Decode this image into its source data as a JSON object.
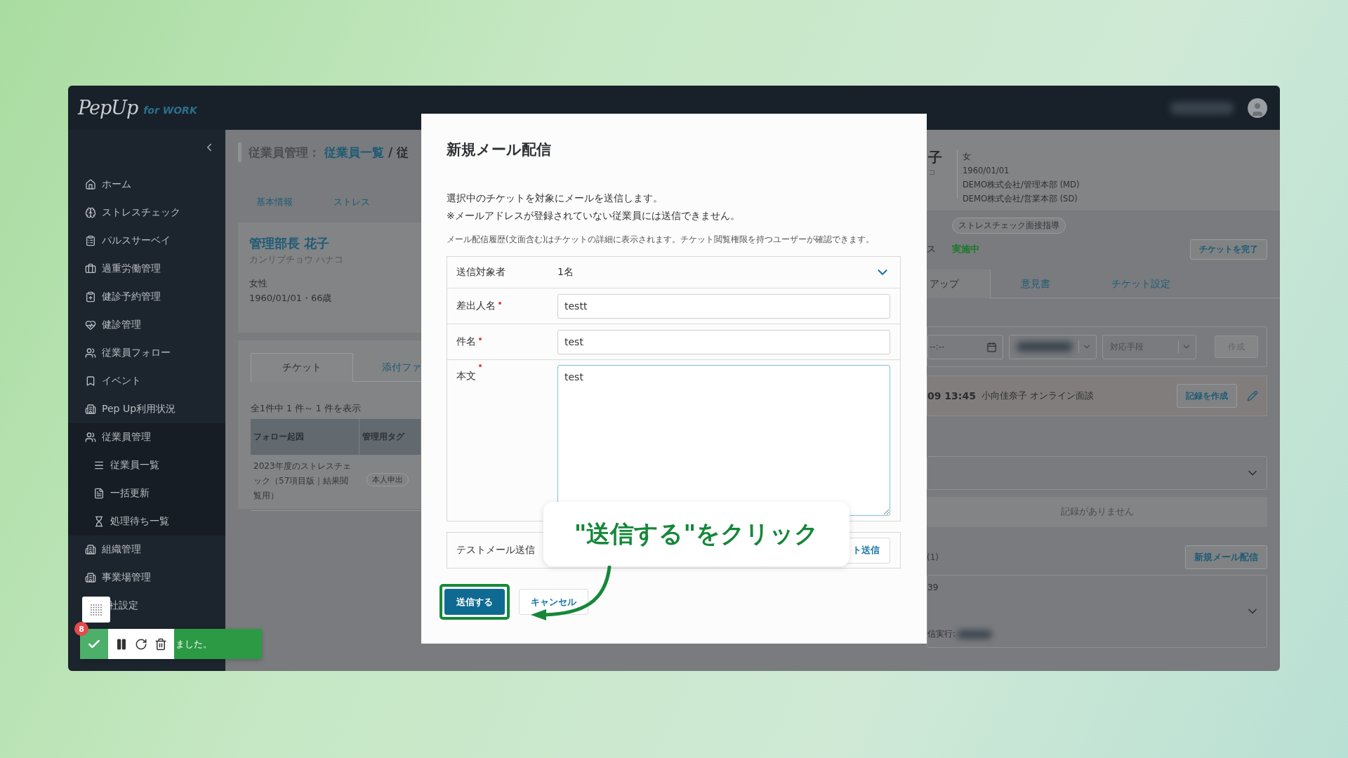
{
  "header": {
    "logo": "PepUp",
    "logo_tagline": "for WORK"
  },
  "sidebar": {
    "items": [
      {
        "label": "ホーム"
      },
      {
        "label": "ストレスチェック"
      },
      {
        "label": "パルスサーベイ"
      },
      {
        "label": "過重労働管理"
      },
      {
        "label": "健診予約管理"
      },
      {
        "label": "健診管理"
      },
      {
        "label": "従業員フォロー"
      },
      {
        "label": "イベント"
      },
      {
        "label": "Pep Up利用状況"
      },
      {
        "label": "従業員管理",
        "children": [
          {
            "label": "従業員一覧"
          },
          {
            "label": "一括更新"
          },
          {
            "label": "処理待ち一覧"
          }
        ]
      },
      {
        "label": "組織管理"
      },
      {
        "label": "事業場管理"
      },
      {
        "label": "社設定"
      }
    ]
  },
  "left": {
    "breadcrumb": [
      {
        "text": "従業員管理：",
        "kind": "section"
      },
      {
        "text": "従業員一覧",
        "kind": "link"
      },
      {
        "text": "/",
        "kind": "separator"
      },
      {
        "text": "従",
        "kind": "current"
      }
    ],
    "tabs": [
      "基本情報",
      "ストレス"
    ],
    "profile": {
      "name": "管理部長 花子",
      "kana": "カンリブチョウ ハナコ",
      "gender": "女性",
      "birth": "1960/01/01・66歳"
    },
    "panel_tabs": [
      {
        "label": "チケット",
        "selected": true
      },
      {
        "label": "添付ファ",
        "selected": false
      }
    ],
    "count": "全1件中 1 件～ 1 件を表示",
    "table": {
      "columns": [
        "フォロー起因",
        "管理用タグ"
      ],
      "rows": [
        {
          "cause": "2023年度のストレスチェック（57項目版｜結果閲覧用）",
          "tag": "本人申出"
        }
      ]
    }
  },
  "right": {
    "name_fragment": "子",
    "kana_fragment": "コ",
    "details": [
      "女",
      "1960/01/01",
      "DEMO株式会社/管理本部 (MD)",
      "DEMO株式会社/営業本部 (SD)"
    ],
    "tag": "ストレスチェック面接指導",
    "status_label": "ス",
    "status": "実施中",
    "complete_button": "チケットを完了",
    "tabs": [
      {
        "label": "アップ",
        "selected": true
      },
      {
        "label": "意見書",
        "selected": false
      },
      {
        "label": "チケット設定",
        "selected": false
      }
    ],
    "form": {
      "time": "--:--",
      "method_placeholder": "対応手段",
      "create_button": "作成",
      "create_disabled": true
    },
    "appointment": {
      "time": "09 13:45",
      "text": "小向佳奈子 オンライン面談",
      "button": "記録を作成"
    },
    "empty_text": "記録がありません",
    "mail_count": "(1)",
    "mail_button": "新規メール配信",
    "mail_item": {
      "time": "39",
      "label": "信実行:"
    }
  },
  "modal": {
    "title": "新規メール配信",
    "intro": [
      "選択中のチケットを対象にメールを送信します。",
      "※メールアドレスが登録されていない従業員には送信できません。"
    ],
    "note": "メール配信履歴(文面含む)はチケットの詳細に表示されます。チケット閲覧権限を持つユーザーが確認できます。",
    "fields": [
      {
        "kind": "select",
        "label": "送信対象者",
        "value": "1名",
        "required": false
      },
      {
        "kind": "input",
        "label": "差出人名",
        "value": "testt",
        "required": true,
        "focused": false
      },
      {
        "kind": "input",
        "label": "件名",
        "value": "test",
        "required": true,
        "focused": false
      },
      {
        "kind": "textarea",
        "label": "本文",
        "value": "test",
        "required": true,
        "focused": true
      }
    ],
    "test_mail": {
      "label": "テストメール送信",
      "button": "ト送信"
    },
    "actions": [
      {
        "label": "送信する",
        "kind": "primary",
        "highlighted": true
      },
      {
        "label": "キャンセル",
        "kind": "secondary",
        "highlighted": false
      }
    ]
  },
  "callout": {
    "text": "\"送信する\"をクリック"
  },
  "recorder": {
    "badge": "8",
    "message": "ました。"
  }
}
